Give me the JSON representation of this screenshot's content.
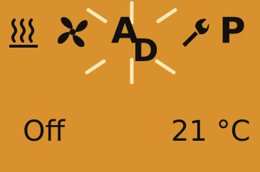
{
  "mode_bar": {
    "heat_icon": "heating-waves-icon",
    "fan_icon": "fan-icon",
    "auto_label": "A",
    "auto_sub_label": "D",
    "wrench_icon": "wrench-icon",
    "program_label": "P"
  },
  "status": {
    "state": "Off",
    "temperature": "21 °C"
  },
  "colors": {
    "background": "#d8912c",
    "foreground": "#111111",
    "highlight": "#fde9b8"
  }
}
